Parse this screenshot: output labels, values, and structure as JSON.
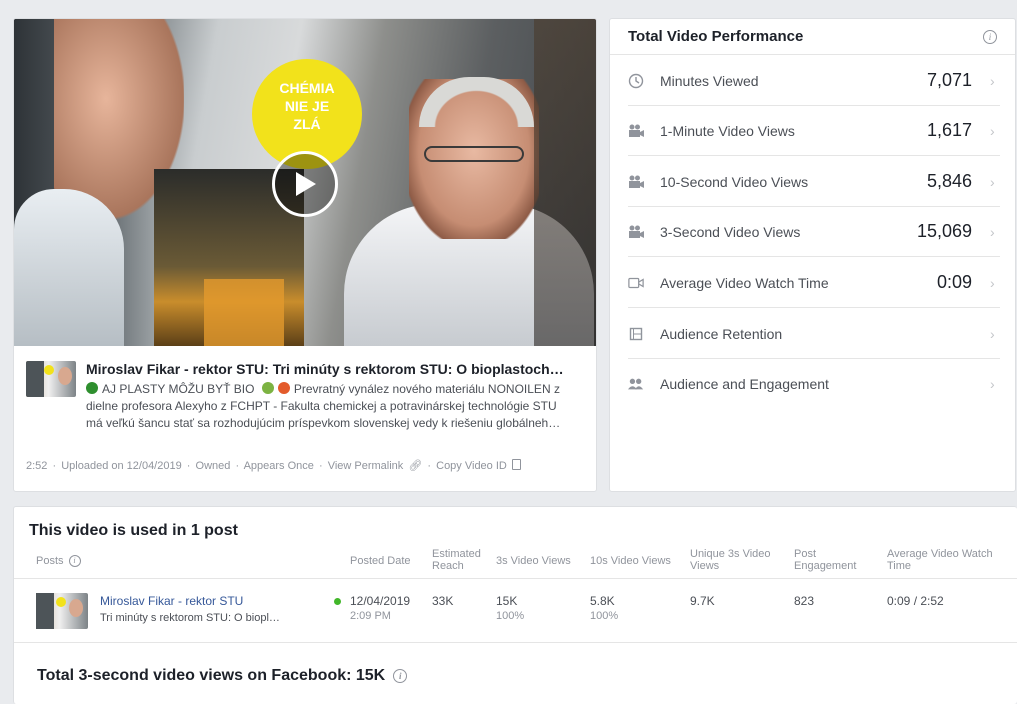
{
  "video": {
    "overlay_badge": [
      "CHÉMIA",
      "NIE JE",
      "ZLÁ"
    ],
    "title": "Miroslav Fikar - rektor STU: Tri minúty s rektorom STU: O bioplastoch…",
    "description_line1": "AJ PLASTY MÔŽU BYŤ BIO",
    "description_line1_rest": "Prevratný vynález nového materiálu NONOILEN z",
    "description_line2": "dielne profesora Alexyho z FCHPT - Fakulta chemickej a potravinárskej technológie STU",
    "description_line3": "má veľkú šancu stať sa rozhodujúcim príspevkom slovenskej vedy k riešeniu globálneh…",
    "meta": {
      "duration": "2:52",
      "uploaded": "Uploaded on 12/04/2019",
      "owned": "Owned",
      "appears": "Appears Once",
      "permalink": "View Permalink",
      "copy_id": "Copy Video ID"
    }
  },
  "performance": {
    "title": "Total Video Performance",
    "metrics": [
      {
        "label": "Minutes Viewed",
        "value": "7,071",
        "icon": "clock-icon"
      },
      {
        "label": "1-Minute Video Views",
        "value": "1,617",
        "icon": "camera-icon"
      },
      {
        "label": "10-Second Video Views",
        "value": "5,846",
        "icon": "camera-icon"
      },
      {
        "label": "3-Second Video Views",
        "value": "15,069",
        "icon": "camera-icon"
      },
      {
        "label": "Average Video Watch Time",
        "value": "0:09",
        "icon": "video-camera-icon"
      },
      {
        "label": "Audience Retention",
        "value": "",
        "icon": "film-icon"
      },
      {
        "label": "Audience and Engagement",
        "value": "",
        "icon": "people-icon"
      }
    ]
  },
  "posts": {
    "heading": "This video is used in 1 post",
    "columns": {
      "posts": "Posts",
      "posted_date": "Posted Date",
      "estimated_reach": "Estimated Reach",
      "views_3s": "3s Video Views",
      "views_10s": "10s Video Views",
      "unique_3s": "Unique 3s Video Views",
      "engagement": "Post Engagement",
      "avg_watch": "Average Video Watch Time"
    },
    "row": {
      "title": "Miroslav Fikar - rektor STU",
      "subtitle": "Tri minúty s rektorom STU: O biopl…",
      "date": "12/04/2019",
      "time": "2:09 PM",
      "reach": "33K",
      "views_3s": "15K",
      "views_3s_pct": "100%",
      "views_10s": "5.8K",
      "views_10s_pct": "100%",
      "unique_3s": "9.7K",
      "engagement": "823",
      "avg_watch": "0:09 / 2:52"
    },
    "total": "Total 3-second video views on Facebook: 15K"
  },
  "colors": {
    "link": "#365899",
    "status_active": "#42b72a",
    "badge": "#f2e21b"
  }
}
